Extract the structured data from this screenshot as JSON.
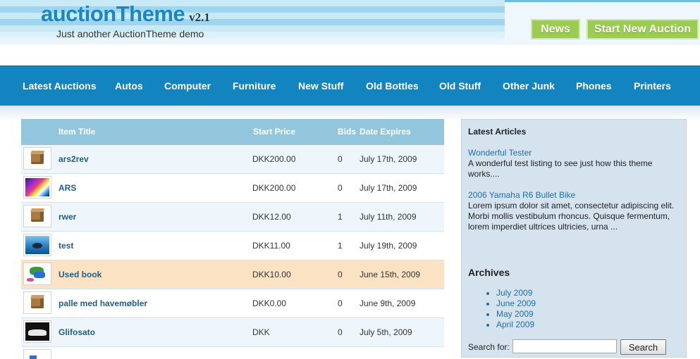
{
  "header": {
    "logo_text": "auctionTheme",
    "version": "v2.1",
    "tagline": "Just another AuctionTheme demo",
    "news_label": "News",
    "start_label": "Start New Auction"
  },
  "nav": [
    "Latest Auctions",
    "Autos",
    "Computer",
    "Furniture",
    "New Stuff",
    "Old Bottles",
    "Old Stuff",
    "Other Junk",
    "Phones",
    "Printers"
  ],
  "table": {
    "headers": {
      "title": "Item Title",
      "price": "Start Price",
      "bids": "Bids",
      "expires": "Date Expires"
    },
    "rows": [
      {
        "thumb": "cardboard-box-image",
        "title": "ars2rev",
        "price": "DKK200.00",
        "bids": "0",
        "expires": "July 17th, 2009"
      },
      {
        "thumb": "colorful-stripes-image",
        "title": "ARS",
        "price": "DKK200.00",
        "bids": "0",
        "expires": "July 17th, 2009"
      },
      {
        "thumb": "cardboard-box-image",
        "title": "rwer",
        "price": "DKK12.00",
        "bids": "1",
        "expires": "July 11th, 2009"
      },
      {
        "thumb": "whale-ocean-image",
        "title": "test",
        "price": "DKK11.00",
        "bids": "1",
        "expires": "July 19th, 2009"
      },
      {
        "thumb": "book-cartoon-image",
        "title": "Used book",
        "price": "DKK10.00",
        "bids": "0",
        "expires": "June 15th, 2009"
      },
      {
        "thumb": "cardboard-box-image",
        "title": "palle med havemøbler",
        "price": "DKK0.00",
        "bids": "0",
        "expires": "June 9th, 2009"
      },
      {
        "thumb": "car-photo-image",
        "title": "Glifosato",
        "price": "DKK",
        "bids": "0",
        "expires": "July 5th, 2009"
      }
    ]
  },
  "sidebar": {
    "articles_heading": "Latest Articles",
    "articles": [
      {
        "title": "Wonderful Tester",
        "excerpt": "A wonderful test listing to see just how this theme works...."
      },
      {
        "title": "2006 Yamaha R6 Bullet Bike",
        "excerpt": "Lorem ipsum dolor sit amet, consectetur adipiscing elit. Morbi mollis vestibulum rhoncus. Quisque fermentum, lorem imperdiet ultrices ultricies, urna ..."
      }
    ],
    "archives_heading": "Archives",
    "archives": [
      "July 2009",
      "June 2009",
      "May 2009",
      "April 2009"
    ],
    "search_label": "Search for:",
    "search_value": "",
    "search_button": "Search"
  },
  "colors": {
    "nav_bg": "#1284c0",
    "button_green": "#9bcc52",
    "table_header": "#92c6dc",
    "row_alt": "#eef5fb",
    "row_highlight": "#fbe2c3",
    "sidebar_bg": "#d5e3ee",
    "link": "#1f6fa8"
  }
}
